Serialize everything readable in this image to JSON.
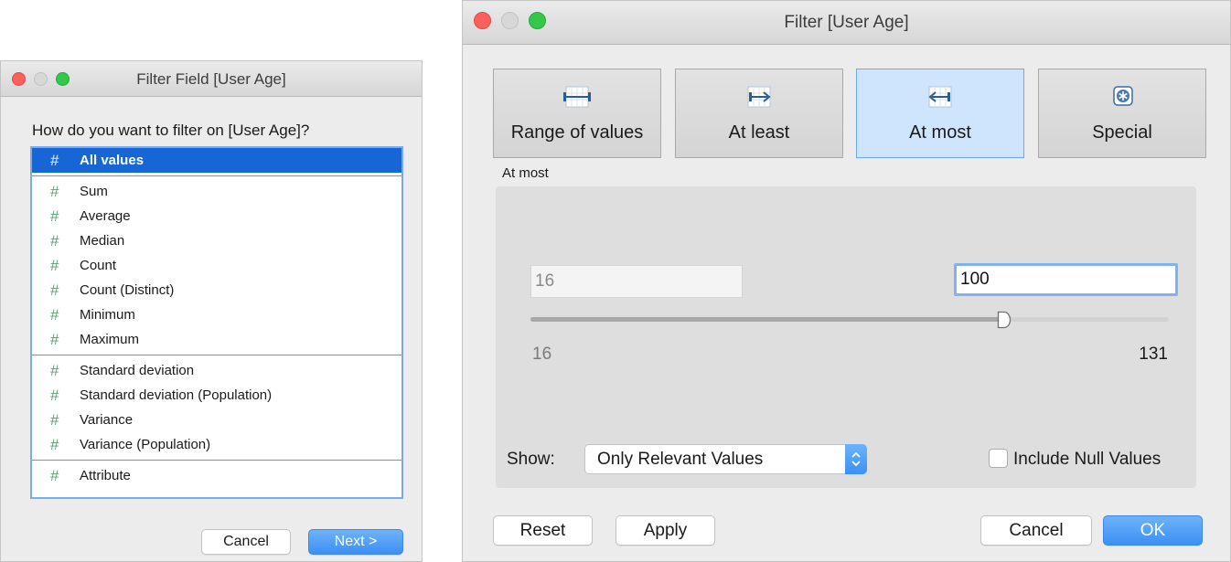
{
  "left_dialog": {
    "title": "Filter Field [User Age]",
    "question": "How do you want to filter on [User Age]?",
    "selected_item": "All values",
    "groups": [
      [
        "Sum",
        "Average",
        "Median",
        "Count",
        "Count (Distinct)",
        "Minimum",
        "Maximum"
      ],
      [
        "Standard deviation",
        "Standard deviation (Population)",
        "Variance",
        "Variance (Population)"
      ],
      [
        "Attribute"
      ]
    ],
    "cancel_label": "Cancel",
    "next_label": "Next >"
  },
  "right_dialog": {
    "title": "Filter [User Age]",
    "tabs": [
      {
        "label": "Range of values",
        "icon": "range-icon"
      },
      {
        "label": "At least",
        "icon": "at-least-icon"
      },
      {
        "label": "At most",
        "icon": "at-most-icon"
      },
      {
        "label": "Special",
        "icon": "special-icon"
      }
    ],
    "active_tab": "At most",
    "section_label": "At most",
    "min_value": "16",
    "max_value": "100",
    "range_min": "16",
    "range_max": "131",
    "show_label": "Show:",
    "show_selected": "Only Relevant Values",
    "include_null_label": "Include Null Values",
    "include_null_checked": false,
    "reset_label": "Reset",
    "apply_label": "Apply",
    "cancel_label": "Cancel",
    "ok_label": "OK"
  },
  "colors": {
    "selection": "#1666d6",
    "accent_blue": "#3d8ff5",
    "active_tab": "#cfe4fd",
    "hash_green": "#5aa079"
  }
}
